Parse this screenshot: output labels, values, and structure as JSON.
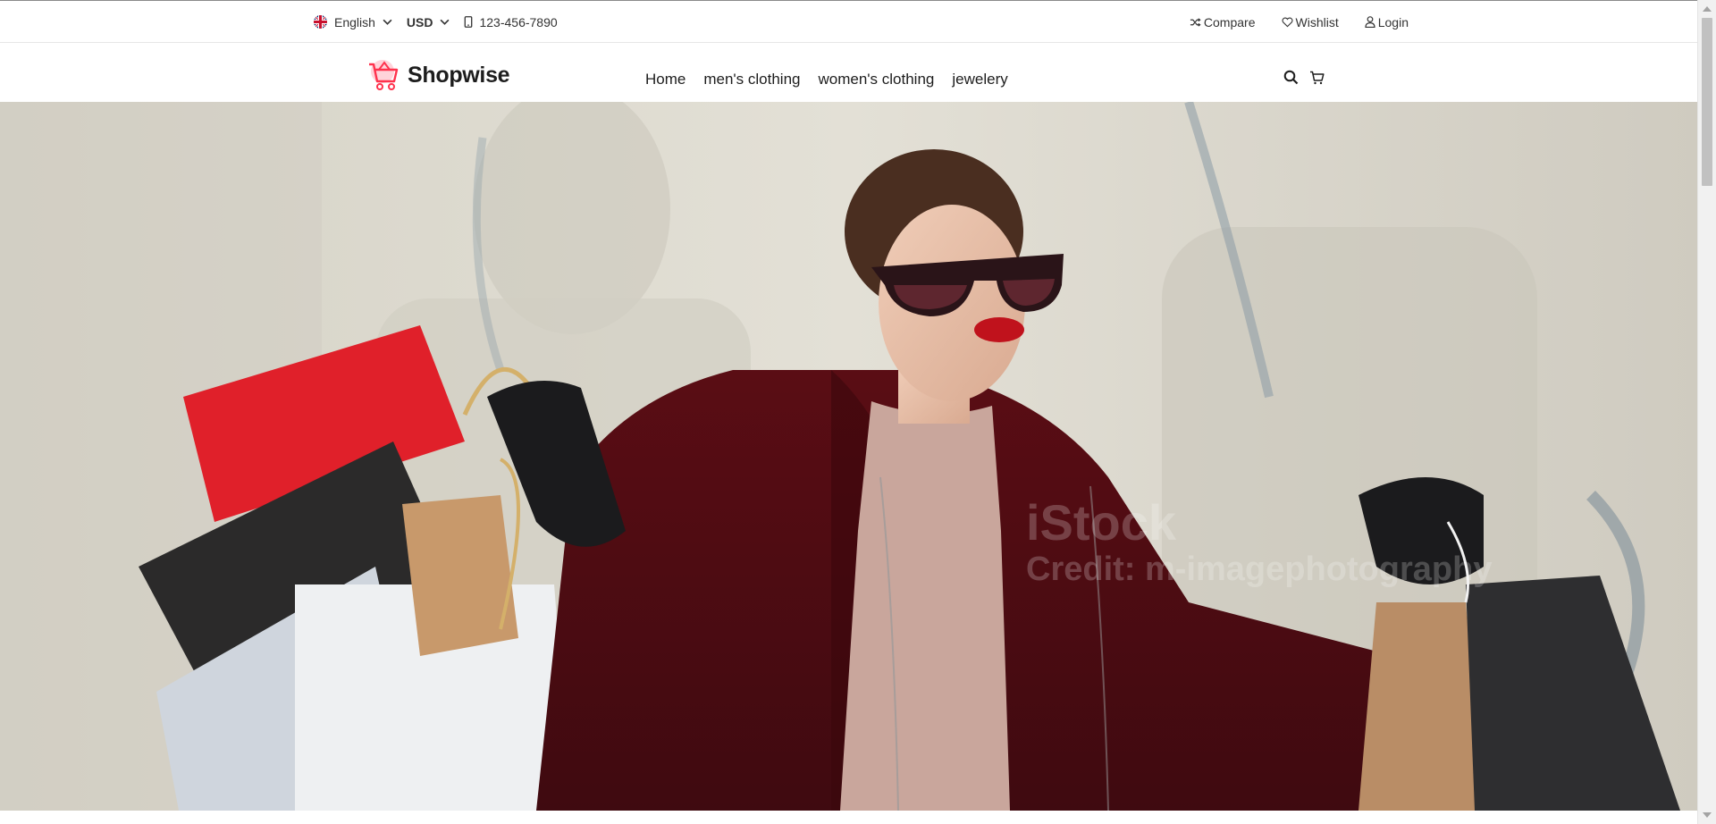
{
  "topbar": {
    "language": "English",
    "currency": "USD",
    "phone": "123-456-7890",
    "compare": "Compare",
    "wishlist": "Wishlist",
    "login": "Login"
  },
  "brand": {
    "name": "Shopwise",
    "accent": "#ff324d"
  },
  "nav": {
    "items": [
      "Home",
      "men's clothing",
      "women's clothing",
      "jewelery"
    ]
  },
  "icons": {
    "language": "uk-flag-icon",
    "phone": "mobile-phone-icon",
    "compare": "shuffle-icon",
    "wishlist": "heart-icon",
    "login": "user-icon",
    "search": "search-icon",
    "cart": "cart-icon"
  },
  "hero": {
    "image": "woman-with-shopping-bags",
    "watermark": [
      "iStock",
      "Credit: m-imagephotography"
    ]
  }
}
